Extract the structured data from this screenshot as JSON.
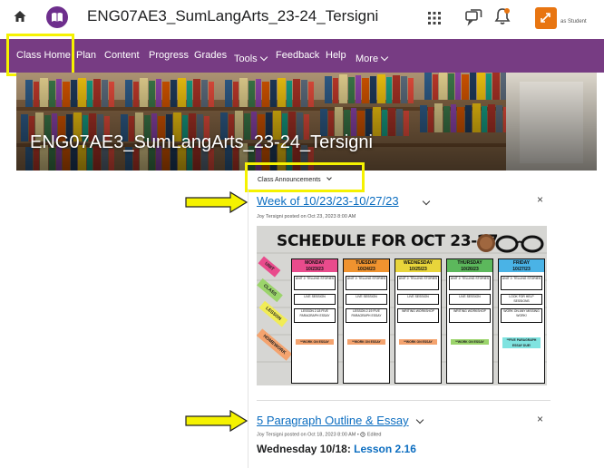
{
  "header": {
    "course_title": "ENG07AE3_SumLangArts_23-24_Tersigni",
    "role_label": "as Student",
    "icons": [
      "home-icon",
      "course-logo-icon",
      "waffle-grid-icon",
      "chat-icon",
      "bell-icon",
      "role-switch-icon"
    ],
    "notification_dot_color": "#e87511"
  },
  "nav": {
    "items": [
      "Class Home",
      "Plan",
      "Content",
      "Progress",
      "Grades",
      "Tools",
      "Feedback",
      "Help",
      "More"
    ],
    "background": "#773c83",
    "highlight_color": "#f5f200"
  },
  "banner": {
    "title": "ENG07AE3_SumLangArts_23-24_Tersigni"
  },
  "widget": {
    "title": "Class Announcements",
    "announcements": [
      {
        "title": "Week of 10/23/23-10/27/23",
        "meta": "Joy Tersigni posted on Oct 23, 2023 8:00 AM",
        "schedule": {
          "title": "SCHEDULE FOR OCT 23-27",
          "tags": [
            "UNIT",
            "CLASS",
            "LESSON",
            "HOMEWORK"
          ],
          "days": [
            {
              "name": "MONDAY",
              "date": "10/23/23",
              "unit": "UNIT 2: TELLING STORIES",
              "class": "LIVE SESSION",
              "lesson": "LESSON 2.18 FIVE PARAGRAPH ESSAY",
              "homework": "**WORK ON ESSAY",
              "color": "#e94b8c"
            },
            {
              "name": "TUESDAY",
              "date": "10/24/23",
              "unit": "UNIT 2: TELLING STORIES",
              "class": "LIVE SESSION",
              "lesson": "LESSON 2.19 FIVE PARAGRAPH ESSAY",
              "homework": "**WORK ON ESSAY",
              "color": "#f0932f"
            },
            {
              "name": "WEDNESDAY",
              "date": "10/25/23",
              "unit": "UNIT 2: TELLING STORIES",
              "class": "LIVE SESSION",
              "lesson": "WRITING WORKSHOP",
              "homework": "**WORK ON ESSAY",
              "color": "#e8d53b"
            },
            {
              "name": "THURSDAY",
              "date": "10/26/23",
              "unit": "UNIT 2: TELLING STORIES",
              "class": "LIVE SESSION",
              "lesson": "WRITING WORKSHOP",
              "homework": "**WORK ON ESSAY",
              "color": "#5cb85c"
            },
            {
              "name": "FRIDAY",
              "date": "10/27/23",
              "unit": "UNIT 2: TELLING STORIES",
              "class": "LOOK FOR HELP SESSIONS",
              "lesson": "WORK ON ANY MISSING WORK!",
              "homework": "**FIVE PARAGRAPH ESSAY DUE!",
              "color": "#4ab3e6"
            }
          ]
        }
      },
      {
        "title": "5 Paragraph Outline & Essay",
        "meta": "Joy Tersigni posted on Oct 18, 2023 8:00 AM",
        "edited_label": "Edited",
        "body_prefix": "Wednesday 10/18: ",
        "body_link": "Lesson 2.16"
      }
    ]
  }
}
